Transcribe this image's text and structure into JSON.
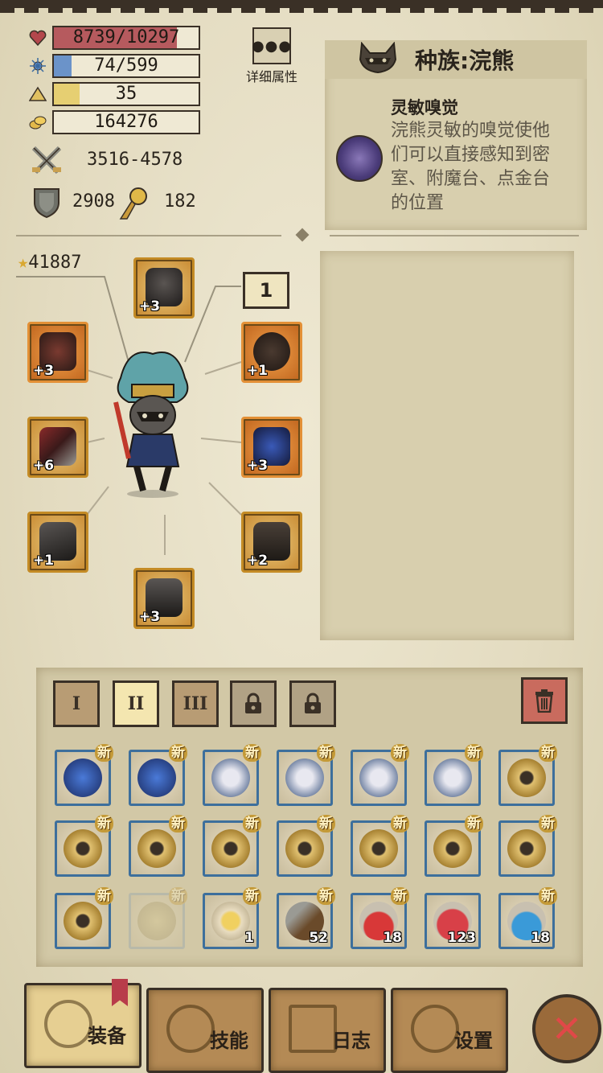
{
  "stats": {
    "hp": "8739/10297",
    "hp_fill": 0.85,
    "mp": "74/599",
    "mp_fill": 0.12,
    "xp": "35",
    "xp_fill": 0.18,
    "gold": "164276",
    "attack": "3516-4578",
    "armor": "2908",
    "magic_resist": "182",
    "colors": {
      "hp": "#b65a5e",
      "mp": "#6b93c9",
      "xp": "#e6cf72"
    }
  },
  "detail_button": {
    "label": "详细属性"
  },
  "race": {
    "title": "种族:浣熊",
    "skill_name": "灵敏嗅觉",
    "skill_desc": "浣熊灵敏的嗅觉使他们可以直接感知到密室、附魔台、点金台的位置"
  },
  "equipment": {
    "score": "41887",
    "level": "1",
    "slots": [
      {
        "name": "helmet",
        "plus": "+3",
        "icon": "helmet-icon"
      },
      {
        "name": "amulet",
        "plus": "+3",
        "icon": "amulet-icon"
      },
      {
        "name": "ring",
        "plus": "+1",
        "icon": "ring-icon"
      },
      {
        "name": "weapon",
        "plus": "+6",
        "icon": "axe-icon"
      },
      {
        "name": "armor",
        "plus": "+3",
        "icon": "armor-icon"
      },
      {
        "name": "gloves",
        "plus": "+1",
        "icon": "gloves-icon"
      },
      {
        "name": "pants",
        "plus": "+2",
        "icon": "pants-icon"
      },
      {
        "name": "boots",
        "plus": "+3",
        "icon": "boots-icon"
      }
    ]
  },
  "inventory": {
    "tabs": [
      "I",
      "II",
      "III"
    ],
    "active_tab": "II",
    "new_label": "新",
    "rows": [
      [
        {
          "icon": "blue-amulet-icon",
          "new": true
        },
        {
          "icon": "blue-amulet-icon",
          "new": true
        },
        {
          "icon": "silver-ring-icon",
          "new": true
        },
        {
          "icon": "silver-ring-icon",
          "new": true
        },
        {
          "icon": "silver-ring-icon",
          "new": true
        },
        {
          "icon": "silver-ring-icon",
          "new": true
        },
        {
          "icon": "gold-ring-icon",
          "new": true
        }
      ],
      [
        {
          "icon": "gold-ring-icon",
          "new": true
        },
        {
          "icon": "gold-ring-icon",
          "new": true
        },
        {
          "icon": "gold-ring-icon",
          "new": true
        },
        {
          "icon": "gold-ring-icon",
          "new": true
        },
        {
          "icon": "gold-ring-icon",
          "new": true
        },
        {
          "icon": "gold-ring-icon",
          "new": true
        },
        {
          "icon": "gold-ring-icon",
          "new": true
        }
      ],
      [
        {
          "icon": "gold-ring-icon",
          "new": true
        },
        {
          "icon": "spoiled-food-icon",
          "new": true,
          "faded": true
        },
        {
          "icon": "scroll-icon",
          "new": true,
          "qty": "1"
        },
        {
          "icon": "pickaxe-icon",
          "new": true,
          "qty": "52"
        },
        {
          "icon": "red-potion-icon",
          "new": true,
          "qty": "18"
        },
        {
          "icon": "red-potion-large-icon",
          "new": false,
          "qty": "123"
        },
        {
          "icon": "blue-potion-icon",
          "new": true,
          "qty": "18"
        }
      ]
    ]
  },
  "nav": {
    "equip": "装备",
    "skills": "技能",
    "log": "日志",
    "settings": "设置"
  }
}
